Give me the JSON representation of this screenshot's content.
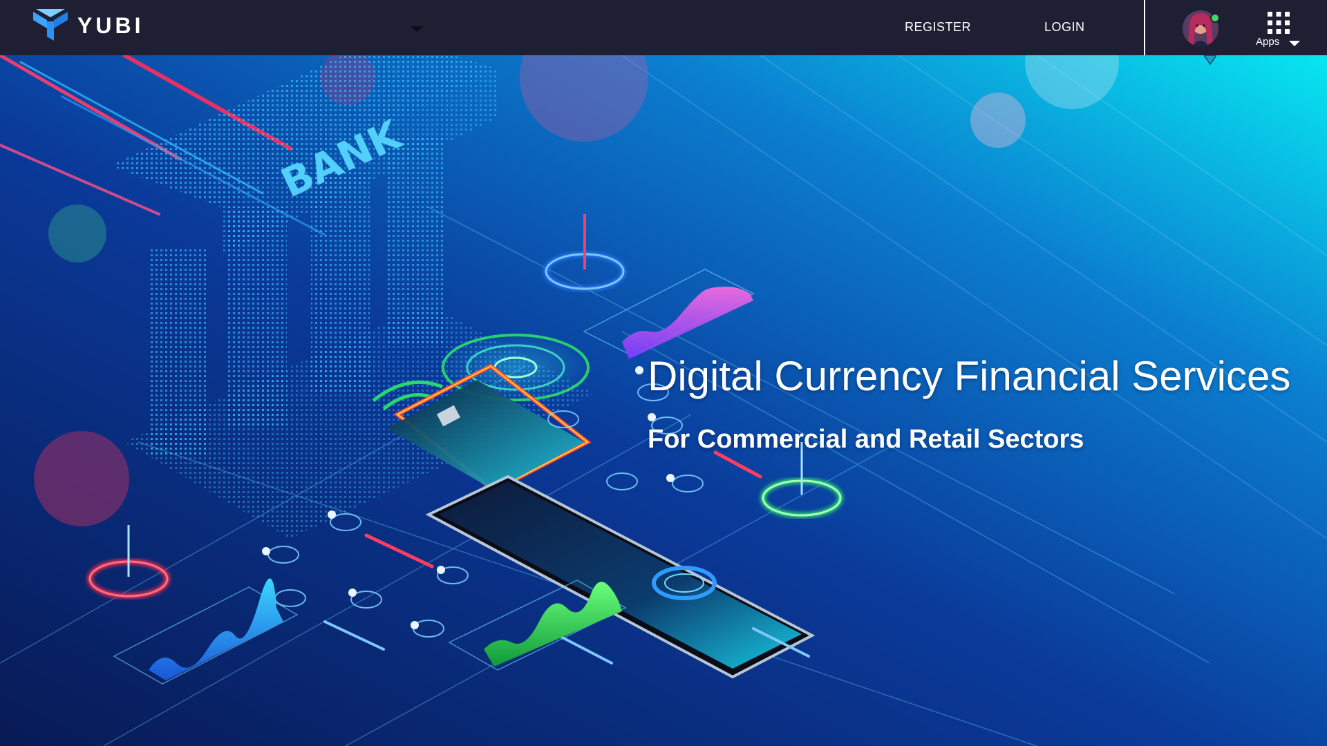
{
  "header": {
    "brand_name": "YUBI",
    "nav": {
      "register_label": "REGISTER",
      "login_label": "LOGIN"
    },
    "user": {
      "online": true
    },
    "apps_label": "Apps"
  },
  "hero": {
    "title": "Digital Currency Financial Services",
    "subtitle": "For Commercial and Retail Sectors",
    "illustration_text": {
      "bank_sign": "BANK"
    }
  },
  "colors": {
    "topbar_bg": "#1e1f33",
    "hero_bg_deep": "#0b1a4a",
    "hero_bg_cyan": "#08e6f0",
    "accent_red": "#ff2a4d",
    "accent_green": "#2ee86a",
    "accent_blue": "#2d7bff",
    "accent_pink": "#ff5cc8"
  }
}
